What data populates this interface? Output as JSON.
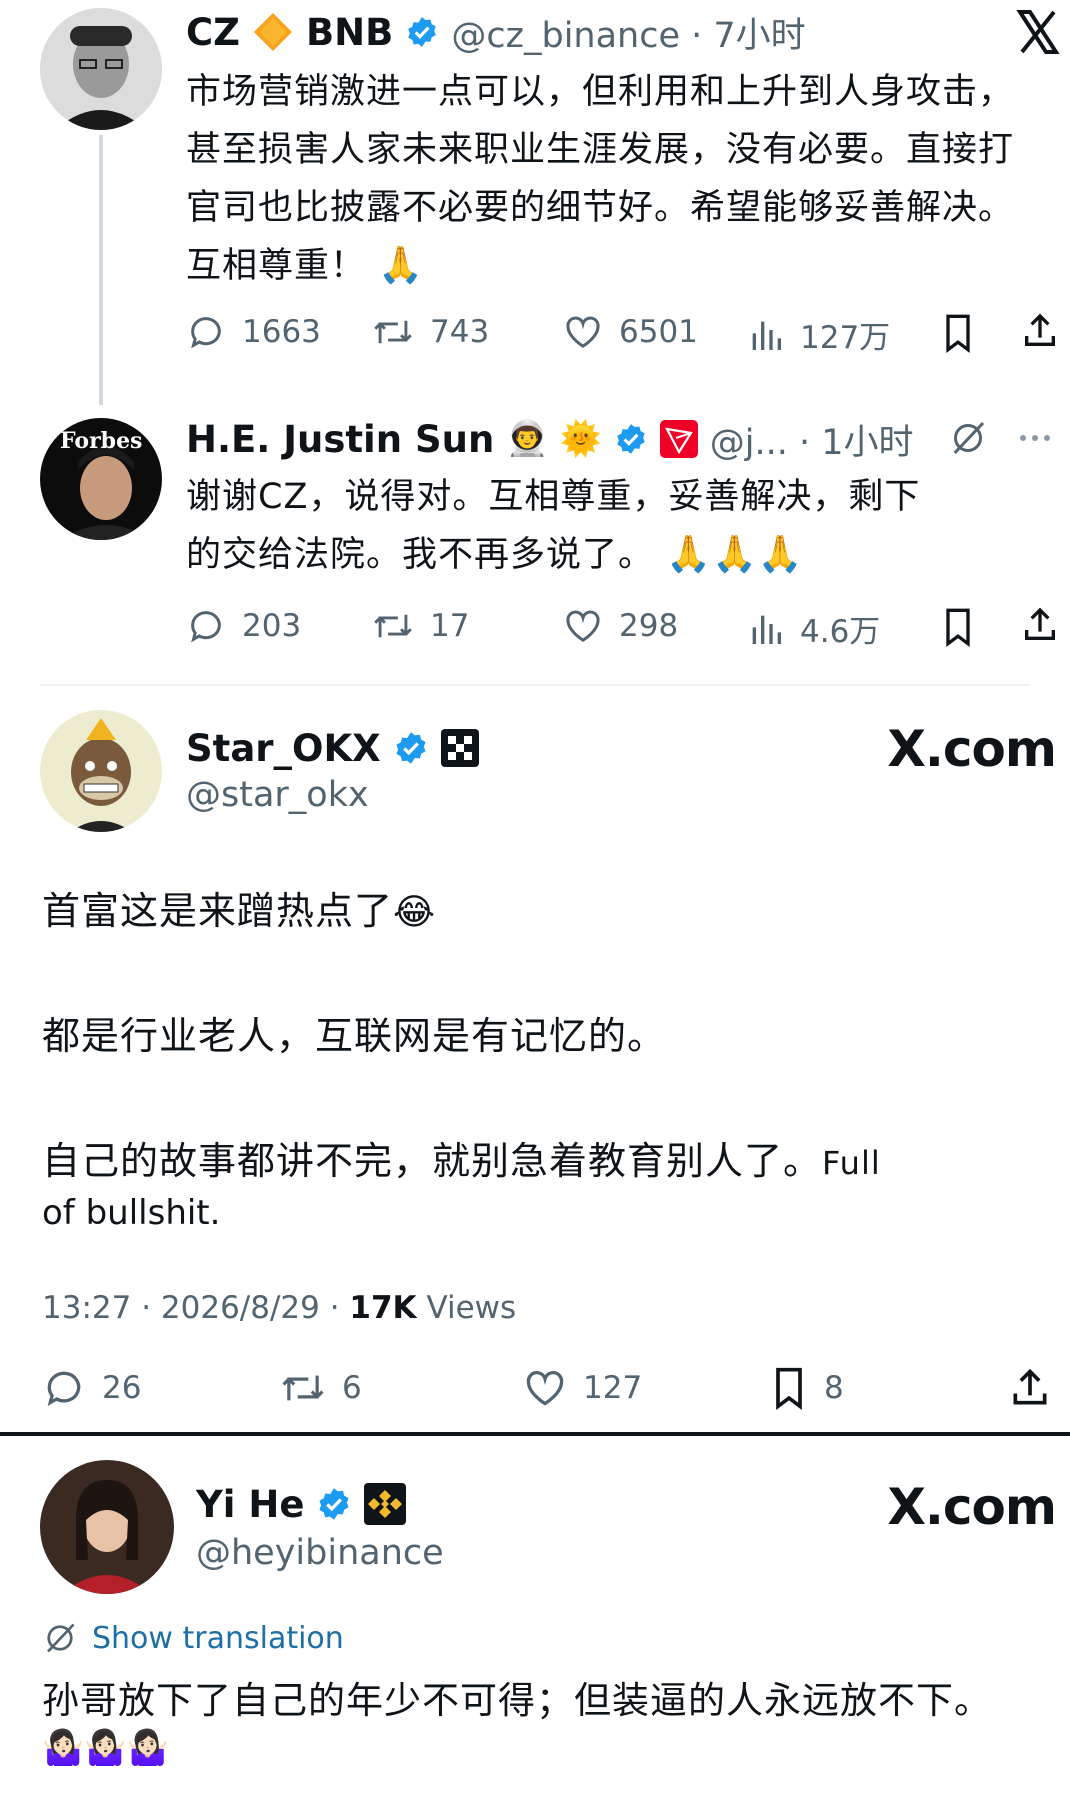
{
  "tweet1": {
    "name": "CZ",
    "name2": "BNB",
    "handle_time": "@cz_binance · 7小时",
    "lines": [
      "市场营销激进一点可以，但利用和上升到人身攻击，",
      "甚至损害人家未来职业生涯发展，没有必要。直接打",
      "官司也比披露不必要的细节好。希望能够妥善解决。",
      "互相尊重！"
    ],
    "emoji": "🙏",
    "stats": {
      "replies": "1663",
      "retweets": "743",
      "likes": "6501",
      "views": "127万"
    }
  },
  "tweet2": {
    "name": "H.E. Justin Sun",
    "emojis": "👨‍🚀 🌞",
    "handle_time": "@j... · 1小时",
    "lines": [
      "谢谢CZ，说得对。互相尊重，妥善解决，剩下",
      "的交给法院。我不再多说了。"
    ],
    "emoji": "🙏🙏🙏",
    "avatar_text": "Forbes",
    "stats": {
      "replies": "203",
      "retweets": "17",
      "likes": "298",
      "views": "4.6万"
    }
  },
  "tweet3": {
    "name": "Star_OKX",
    "handle": "@star_okx",
    "site": "X.com",
    "para1": "首富这是来蹭热点了",
    "para1_emoji": "😂",
    "para2": "都是行业老人，互联网是有记忆的。",
    "para3a": "自己的故事都讲不完，就别急着教育别人了。",
    "para3b": "Full",
    "para3c": "of bullshit.",
    "meta_time": "13:27 · 2026/8/29 · ",
    "meta_views_count": "17K",
    "meta_views_label": " Views",
    "stats": {
      "replies": "26",
      "retweets": "6",
      "likes": "127",
      "bookmarks": "8"
    }
  },
  "tweet4": {
    "name": "Yi He",
    "handle": "@heyibinance",
    "site": "X.com",
    "translate": "Show translation",
    "line": "孙哥放下了自己的年少不可得；但装逼的人永远放不下。",
    "emoji": "🤷🏻‍♀️🤷🏻‍♀️🤷🏻‍♀️"
  },
  "colors": {
    "verified": "#1d9bf0",
    "muted": "#536471",
    "text": "#0f1419",
    "bnb": "#f3ba2f",
    "tron": "#ef0027"
  }
}
